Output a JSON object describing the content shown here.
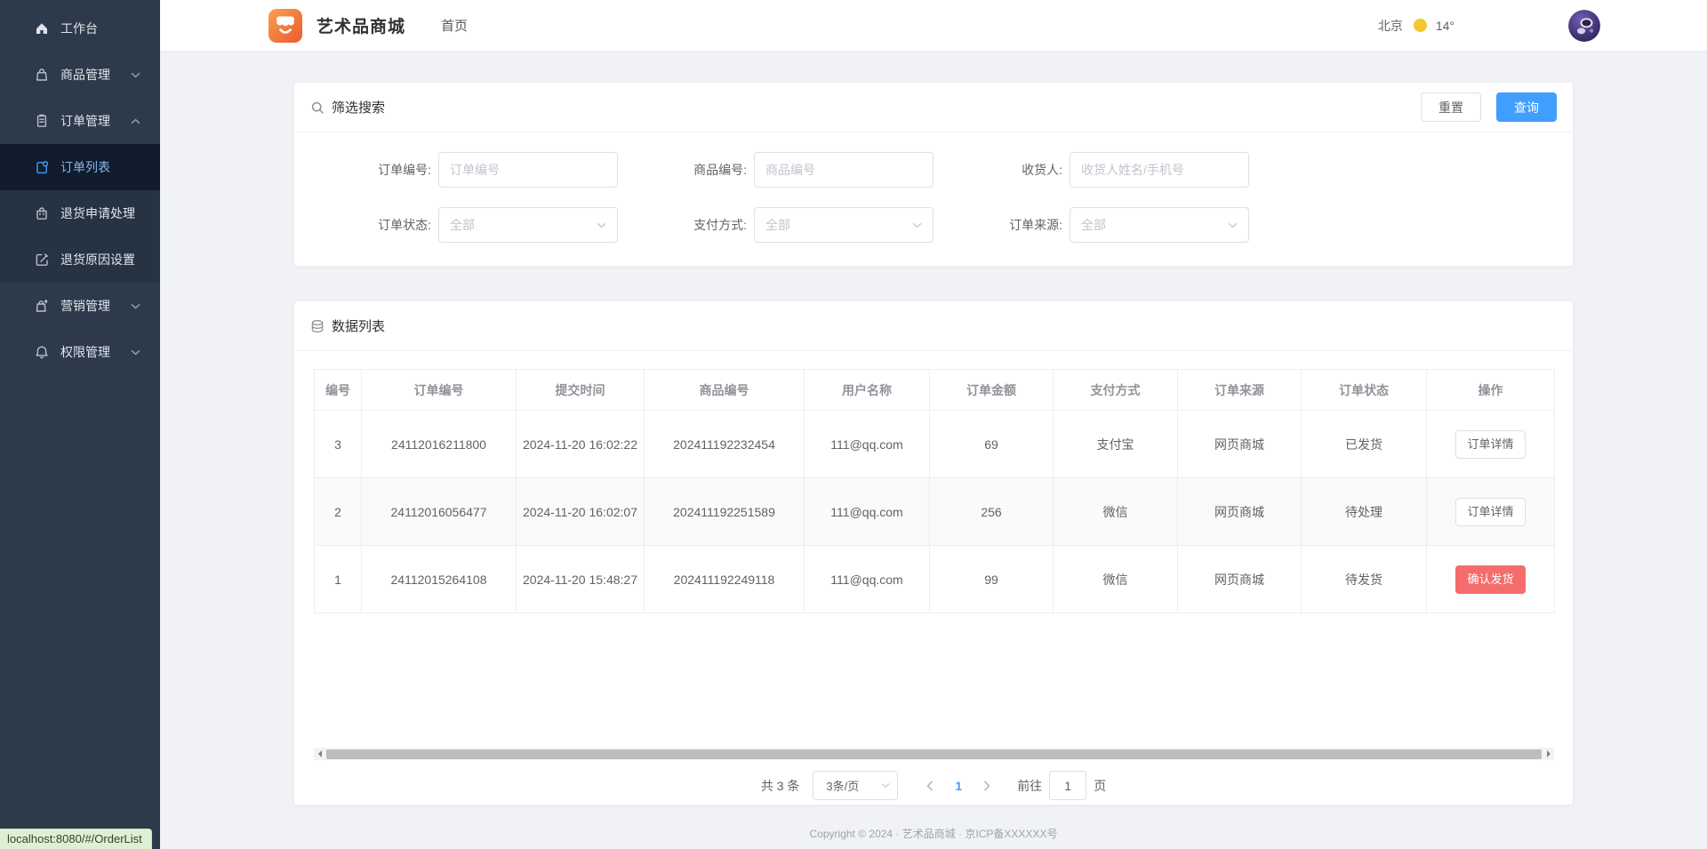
{
  "page": {
    "url_status": "localhost:8080/#/OrderList"
  },
  "header": {
    "brand": "艺术品商城",
    "nav_home": "首页",
    "weather": {
      "city": "北京",
      "temp": "14°"
    }
  },
  "sidebar": {
    "items": [
      {
        "label": "工作台"
      },
      {
        "label": "商品管理"
      },
      {
        "label": "订单管理"
      },
      {
        "label": "订单列表"
      },
      {
        "label": "退货申请处理"
      },
      {
        "label": "退货原因设置"
      },
      {
        "label": "营销管理"
      },
      {
        "label": "权限管理"
      }
    ]
  },
  "filter": {
    "title": "筛选搜索",
    "reset": "重置",
    "submit": "查询",
    "fields": {
      "order_no": {
        "label": "订单编号:",
        "placeholder": "订单编号"
      },
      "product_no": {
        "label": "商品编号:",
        "placeholder": "商品编号"
      },
      "receiver": {
        "label": "收货人:",
        "placeholder": "收货人姓名/手机号"
      },
      "order_status": {
        "label": "订单状态:",
        "value": "全部"
      },
      "pay_method": {
        "label": "支付方式:",
        "value": "全部"
      },
      "order_source": {
        "label": "订单来源:",
        "value": "全部"
      }
    }
  },
  "list": {
    "title": "数据列表",
    "columns": [
      "编号",
      "订单编号",
      "提交时间",
      "商品编号",
      "用户名称",
      "订单金额",
      "支付方式",
      "订单来源",
      "订单状态",
      "操作"
    ],
    "rows": [
      {
        "id": "3",
        "order_no": "24112016211800",
        "submitted": "2024-11-20 16:02:22",
        "product_no": "202411192232454",
        "user": "111@qq.com",
        "amount": "69",
        "pay": "支付宝",
        "source": "网页商城",
        "status": "已发货",
        "action": "订单详情"
      },
      {
        "id": "2",
        "order_no": "24112016056477",
        "submitted": "2024-11-20 16:02:07",
        "product_no": "202411192251589",
        "user": "111@qq.com",
        "amount": "256",
        "pay": "微信",
        "source": "网页商城",
        "status": "待处理",
        "action": "订单详情"
      },
      {
        "id": "1",
        "order_no": "24112015264108",
        "submitted": "2024-11-20 15:48:27",
        "product_no": "202411192249118",
        "user": "111@qq.com",
        "amount": "99",
        "pay": "微信",
        "source": "网页商城",
        "status": "待发货",
        "action": "确认发货"
      }
    ]
  },
  "pagination": {
    "total": "共 3 条",
    "page_size": "3条/页",
    "current_page": "1",
    "goto_label": "前往",
    "goto_value": "1",
    "goto_unit": "页"
  },
  "footer": {
    "copyright": "Copyright © 2024 · 艺术品商城 · 京ICP备XXXXXX号"
  },
  "icons": {
    "brand": "storefront-icon",
    "filter_title": "search-icon",
    "list_title": "database-icon",
    "weather": "sun-icon",
    "avatar": "astronaut-avatar"
  },
  "colors": {
    "accent": "#409eff",
    "danger": "#f56c6c",
    "sidebar_bg": "#2d3a4b",
    "sidebar_submenu_bg": "#263343",
    "sidebar_active_bg": "#101b2b",
    "page_bg": "#f0f2f5",
    "sun": "#f6c62d",
    "logo_gradient_from": "#fa9e52",
    "logo_gradient_to": "#ec5b2d"
  }
}
